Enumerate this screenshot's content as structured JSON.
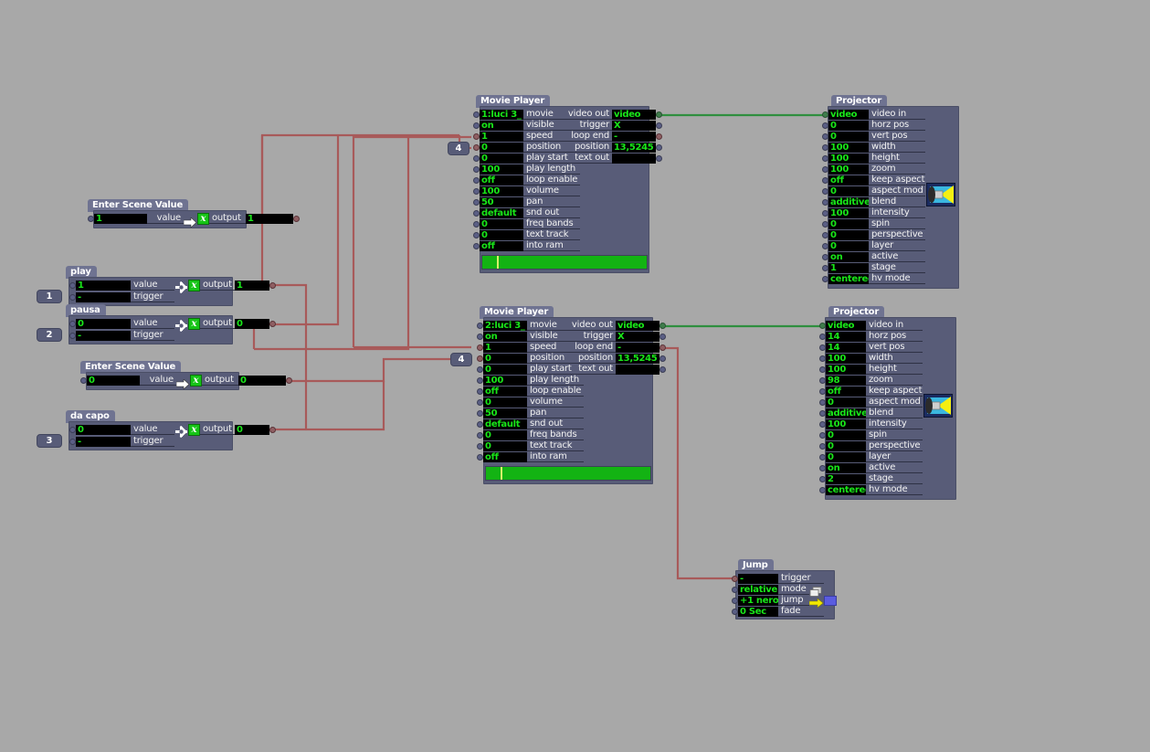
{
  "canvas": {
    "background": "#a8a8a8",
    "wire_color": "#a85a5a",
    "video_wire_color": "#2f8f3f"
  },
  "nodes": {
    "scene_value_1": {
      "title": "Enter Scene Value",
      "rows": [
        {
          "value": "1",
          "label": "value"
        }
      ],
      "output_label": "output",
      "output_value": "1",
      "icons": {
        "arrow": "arrow-right-icon",
        "x": "x-function-icon"
      }
    },
    "play": {
      "title": "play",
      "rows": [
        {
          "value": "1",
          "label": "value"
        },
        {
          "value": "-",
          "label": "trigger"
        }
      ],
      "output_label": "output",
      "output_value": "1",
      "tag": "1",
      "icons": {
        "sparkle": "sparkle-icon",
        "x": "x-function-icon"
      }
    },
    "pausa": {
      "title": "pausa",
      "rows": [
        {
          "value": "0",
          "label": "value"
        },
        {
          "value": "-",
          "label": "trigger"
        }
      ],
      "output_label": "output",
      "output_value": "0",
      "tag": "2",
      "icons": {
        "sparkle": "sparkle-icon",
        "x": "x-function-icon"
      }
    },
    "scene_value_2": {
      "title": "Enter Scene Value",
      "rows": [
        {
          "value": "0",
          "label": "value"
        }
      ],
      "output_label": "output",
      "output_value": "0",
      "icons": {
        "arrow": "arrow-right-icon",
        "x": "x-function-icon"
      }
    },
    "da_capo": {
      "title": "da capo",
      "rows": [
        {
          "value": "0",
          "label": "value"
        },
        {
          "value": "-",
          "label": "trigger"
        }
      ],
      "output_label": "output",
      "output_value": "0",
      "tag": "3",
      "icons": {
        "sparkle": "sparkle-icon",
        "x": "x-function-icon"
      }
    },
    "movie_player_1": {
      "title": "Movie Player",
      "inputs": [
        {
          "value": "1:luci 3_",
          "label": "movie"
        },
        {
          "value": "on",
          "label": "visible"
        },
        {
          "value": "1",
          "label": "speed"
        },
        {
          "value": "0",
          "label": "position"
        },
        {
          "value": "0",
          "label": "play start"
        },
        {
          "value": "100",
          "label": "play length"
        },
        {
          "value": "off",
          "label": "loop enable"
        },
        {
          "value": "100",
          "label": "volume"
        },
        {
          "value": "50",
          "label": "pan"
        },
        {
          "value": "default",
          "label": "snd out"
        },
        {
          "value": "0",
          "label": "freq bands"
        },
        {
          "value": "0",
          "label": "text track"
        },
        {
          "value": "off",
          "label": "into ram"
        }
      ],
      "outputs": [
        {
          "label": "video out",
          "value": "video"
        },
        {
          "label": "trigger",
          "value": "X"
        },
        {
          "label": "loop end",
          "value": "-"
        },
        {
          "label": "position",
          "value": "13,5245"
        },
        {
          "label": "text out",
          "value": ""
        }
      ],
      "progress_percent": 100,
      "playhead_percent": 9,
      "tag": "4"
    },
    "movie_player_2": {
      "title": "Movie Player",
      "inputs": [
        {
          "value": "2:luci 3_",
          "label": "movie"
        },
        {
          "value": "on",
          "label": "visible"
        },
        {
          "value": "1",
          "label": "speed"
        },
        {
          "value": "0",
          "label": "position"
        },
        {
          "value": "0",
          "label": "play start"
        },
        {
          "value": "100",
          "label": "play length"
        },
        {
          "value": "off",
          "label": "loop enable"
        },
        {
          "value": "0",
          "label": "volume"
        },
        {
          "value": "50",
          "label": "pan"
        },
        {
          "value": "default",
          "label": "snd out"
        },
        {
          "value": "0",
          "label": "freq bands"
        },
        {
          "value": "0",
          "label": "text track"
        },
        {
          "value": "off",
          "label": "into ram"
        }
      ],
      "outputs": [
        {
          "label": "video out",
          "value": "video"
        },
        {
          "label": "trigger",
          "value": "X"
        },
        {
          "label": "loop end",
          "value": "-"
        },
        {
          "label": "position",
          "value": "13,5245"
        },
        {
          "label": "text out",
          "value": ""
        }
      ],
      "progress_percent": 100,
      "playhead_percent": 9,
      "tag": "4"
    },
    "projector_1": {
      "title": "Projector",
      "icon": "projector-icon",
      "inputs": [
        {
          "value": "video",
          "label": "video in"
        },
        {
          "value": "0",
          "label": "horz pos"
        },
        {
          "value": "0",
          "label": "vert pos"
        },
        {
          "value": "100",
          "label": "width"
        },
        {
          "value": "100",
          "label": "height"
        },
        {
          "value": "100",
          "label": "zoom"
        },
        {
          "value": "off",
          "label": "keep aspect"
        },
        {
          "value": "0",
          "label": "aspect mod"
        },
        {
          "value": "additive",
          "label": "blend"
        },
        {
          "value": "100",
          "label": "intensity"
        },
        {
          "value": "0",
          "label": "spin"
        },
        {
          "value": "0",
          "label": "perspective"
        },
        {
          "value": "0",
          "label": "layer"
        },
        {
          "value": "on",
          "label": "active"
        },
        {
          "value": "1",
          "label": "stage"
        },
        {
          "value": "centered",
          "label": "hv mode"
        }
      ]
    },
    "projector_2": {
      "title": "Projector",
      "icon": "projector-icon",
      "inputs": [
        {
          "value": "video",
          "label": "video in"
        },
        {
          "value": "14",
          "label": "horz pos"
        },
        {
          "value": "14",
          "label": "vert pos"
        },
        {
          "value": "100",
          "label": "width"
        },
        {
          "value": "100",
          "label": "height"
        },
        {
          "value": "98",
          "label": "zoom"
        },
        {
          "value": "off",
          "label": "keep aspect"
        },
        {
          "value": "0",
          "label": "aspect mod"
        },
        {
          "value": "additive",
          "label": "blend"
        },
        {
          "value": "100",
          "label": "intensity"
        },
        {
          "value": "0",
          "label": "spin"
        },
        {
          "value": "0",
          "label": "perspective"
        },
        {
          "value": "0",
          "label": "layer"
        },
        {
          "value": "on",
          "label": "active"
        },
        {
          "value": "2",
          "label": "stage"
        },
        {
          "value": "centered",
          "label": "hv mode"
        }
      ]
    },
    "jump": {
      "title": "Jump",
      "inputs": [
        {
          "value": "-",
          "label": "trigger"
        },
        {
          "value": "relative",
          "label": "mode"
        },
        {
          "value": "+1 nero",
          "label": "jump"
        },
        {
          "value": "0 Sec",
          "label": "fade"
        }
      ],
      "icons": {
        "mode": "pages-icon",
        "jump": "arrow-right-yellow-icon",
        "swatch": "color-swatch-icon"
      }
    }
  }
}
